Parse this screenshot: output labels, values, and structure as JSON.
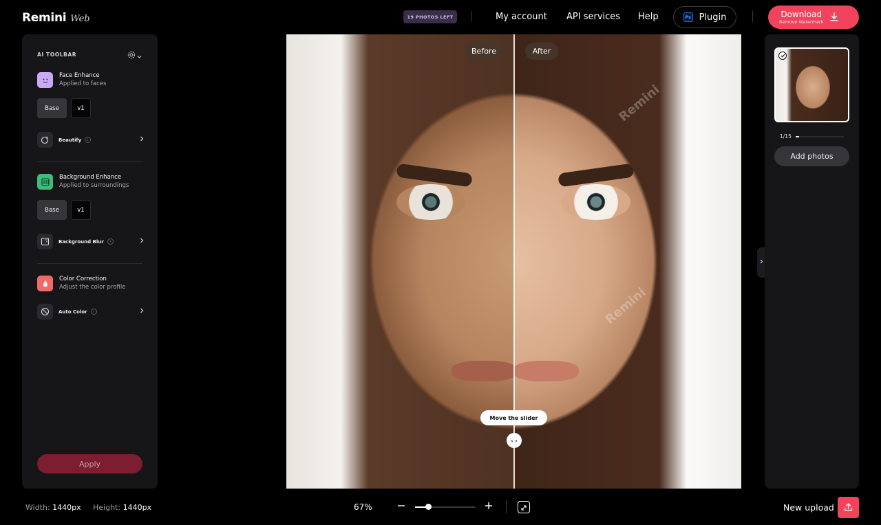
{
  "app": {
    "brand": "Remini",
    "sub": "Web"
  },
  "header": {
    "photos_left": "19 PHOTOS LEFT",
    "nav": [
      "My account",
      "API services",
      "Help"
    ],
    "plugin": {
      "badge": "Ps",
      "label": "Plugin"
    },
    "download": {
      "label": "Download",
      "sub": "Remove Watermark"
    }
  },
  "toolbar": {
    "title": "AI TOOLBAR",
    "sections": [
      {
        "title": "Face Enhance",
        "subtitle": "Applied to faces",
        "toggle": [
          "Base",
          "v1"
        ],
        "option": "Beautify"
      },
      {
        "title": "Background Enhance",
        "subtitle": "Applied to surroundings",
        "toggle": [
          "Base",
          "v1"
        ],
        "option": "Background Blur"
      },
      {
        "title": "Color Correction",
        "subtitle": "Adjust the color profile",
        "option": "Auto Color"
      }
    ],
    "info_glyph": "i",
    "apply": "Apply"
  },
  "compare": {
    "before": "Before",
    "after": "After",
    "tooltip": "Move the slider",
    "handle_glyph": "‹ ›",
    "watermark": "Remini",
    "slider_position": 0.5
  },
  "gallery": {
    "counter": "1/15",
    "progress": 0.0667,
    "add_photos": "Add photos"
  },
  "footer": {
    "width_label": "Width:",
    "width_value": "1440px",
    "height_label": "Height:",
    "height_value": "1440px",
    "zoom": "67%",
    "zoom_fraction": 0.22,
    "new_upload": "New upload"
  },
  "colors": {
    "accent": "#f2435c",
    "panel": "#161619",
    "apply_disabled": "#7d1d30"
  },
  "icons": [
    "settings-icon",
    "face-icon",
    "beautify-icon",
    "background-icon",
    "blur-icon",
    "color-drop-icon",
    "auto-color-icon",
    "download-icon",
    "upload-icon",
    "fit-screen-icon",
    "check-icon",
    "chevron-right-icon"
  ]
}
